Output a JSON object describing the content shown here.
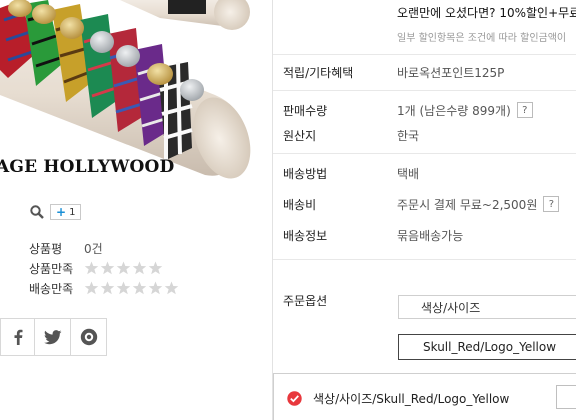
{
  "product": {
    "brand_text": "AGE HOLLYWOOD",
    "share_count": "1",
    "stats": [
      {
        "label": "상품평",
        "value": "0건"
      },
      {
        "label": "상품만족",
        "stars": 0
      },
      {
        "label": "배송만족",
        "stars": 0
      }
    ]
  },
  "social": [
    "facebook-icon",
    "twitter-icon",
    "kakaostory-icon"
  ],
  "promo": {
    "title": "오랜만에 오셨다면? 10%할인+무료",
    "subtitle": "일부 할인항목은 조건에 따라 할인금액이"
  },
  "info": {
    "points": {
      "label": "적립/기타혜택",
      "value": "바로옥션포인트125P"
    },
    "sales": {
      "label": "판매수량",
      "value": "1개 (남은수량 899개)",
      "help": "?"
    },
    "origin": {
      "label": "원산지",
      "value": "한국"
    },
    "ship_method": {
      "label": "배송방법",
      "value": "택배"
    },
    "ship_fee": {
      "label": "배송비",
      "value": "주문시 결제 무료~2,500원",
      "help": "?"
    },
    "ship_info": {
      "label": "배송정보",
      "value": "묶음배송가능"
    }
  },
  "order": {
    "label": "주문옵션",
    "select1": "색상/사이즈",
    "select2": "Skull_Red/Logo_Yellow",
    "chosen": "색상/사이즈/Skull_Red/Logo_Yellow"
  },
  "colors": {
    "accent": "#1a8fd6",
    "check": "#e8383d",
    "star": "#d6d6d6"
  }
}
